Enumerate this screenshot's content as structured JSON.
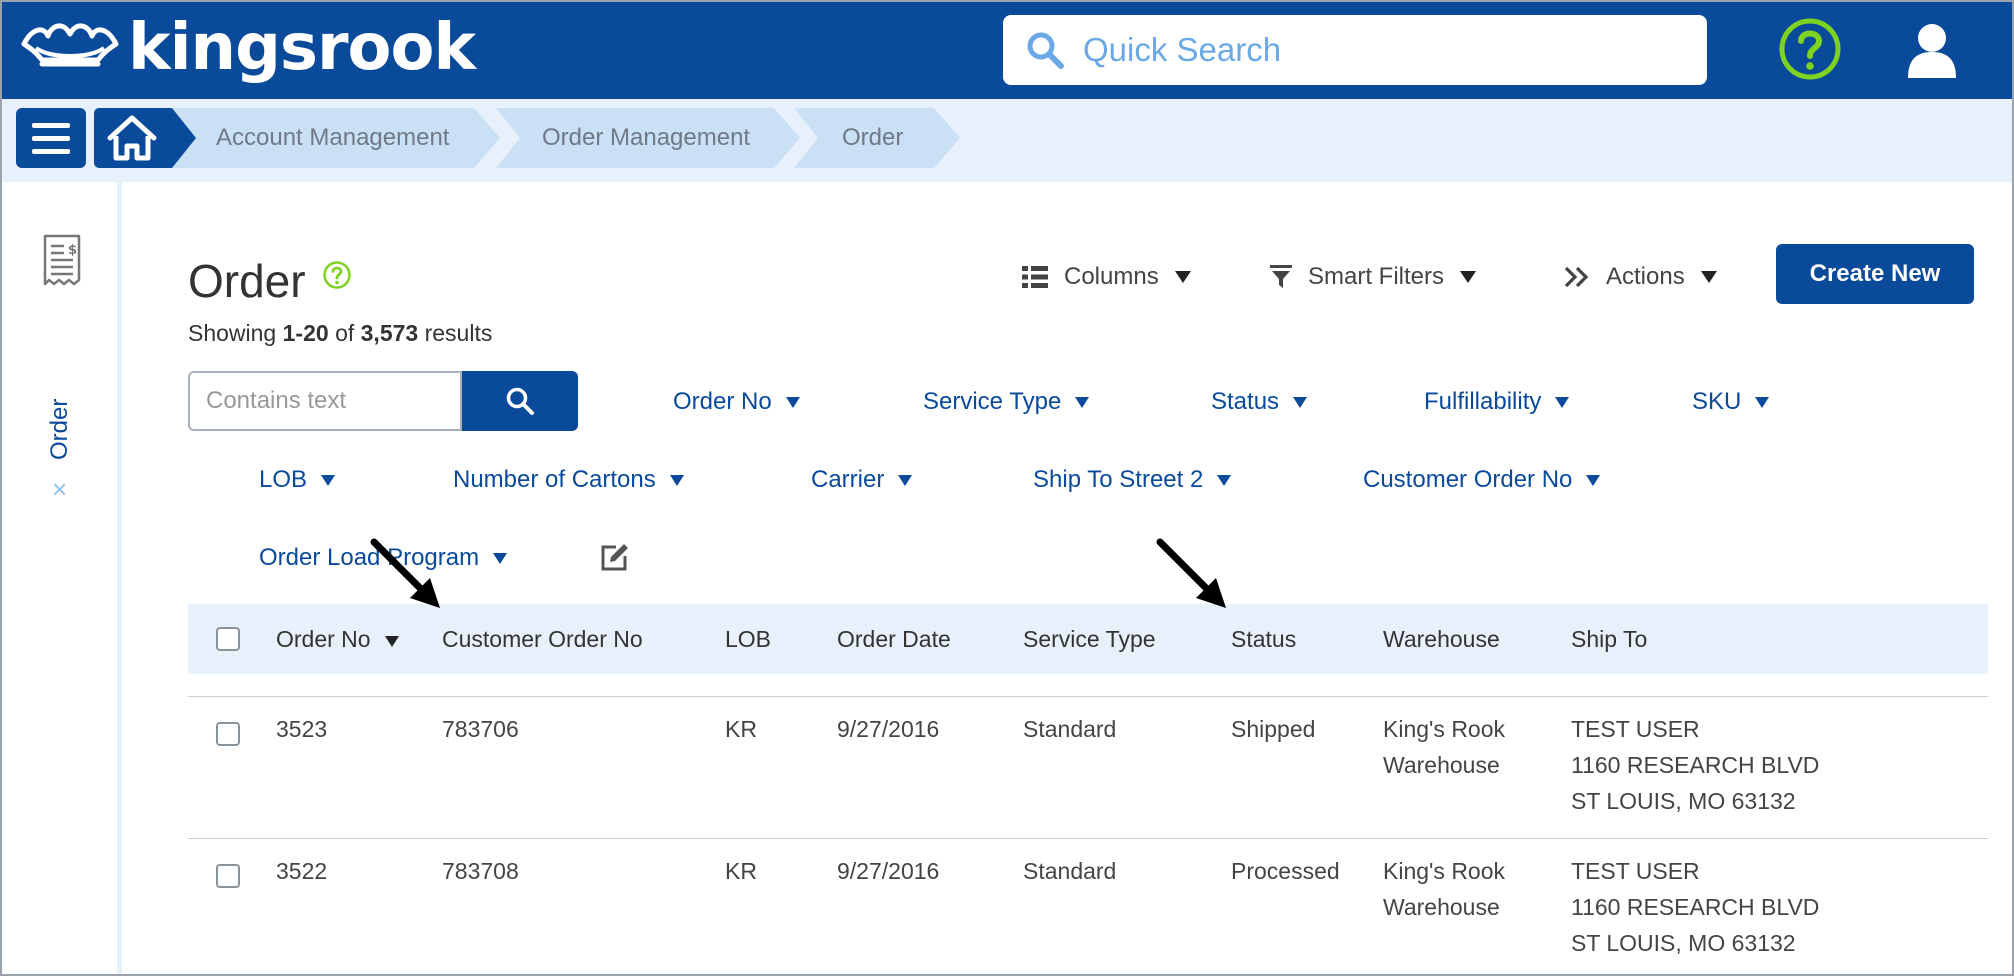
{
  "header": {
    "brand": "kingsrook",
    "search_placeholder": "Quick Search"
  },
  "breadcrumb": [
    "Account Management",
    "Order Management",
    "Order"
  ],
  "sidebar": {
    "tab_label": "Order",
    "close_glyph": "×"
  },
  "page": {
    "title": "Order",
    "showing_prefix": "Showing",
    "showing_range": "1-20",
    "showing_of": "of",
    "showing_total": "3,573",
    "showing_suffix": "results"
  },
  "toolbar": {
    "columns": "Columns",
    "smart_filters": "Smart Filters",
    "actions": "Actions",
    "create_new": "Create New"
  },
  "filters": {
    "text_placeholder": "Contains text",
    "chips": [
      "Order No",
      "Service Type",
      "Status",
      "Fulfillability",
      "SKU",
      "LOB",
      "Number of Cartons",
      "Carrier",
      "Ship To Street 2",
      "Customer Order No",
      "Order Load Program"
    ]
  },
  "table": {
    "columns": [
      "Order No",
      "Customer Order No",
      "LOB",
      "Order Date",
      "Service Type",
      "Status",
      "Warehouse",
      "Ship To"
    ],
    "rows": [
      {
        "order_no": "3523",
        "customer_order_no": "783706",
        "lob": "KR",
        "order_date": "9/27/2016",
        "service_type": "Standard",
        "status": "Shipped",
        "warehouse_1": "King's Rook",
        "warehouse_2": "Warehouse",
        "ship_to_1": "TEST USER",
        "ship_to_2": "1160 RESEARCH BLVD",
        "ship_to_3": "ST LOUIS, MO 63132"
      },
      {
        "order_no": "3522",
        "customer_order_no": "783708",
        "lob": "KR",
        "order_date": "9/27/2016",
        "service_type": "Standard",
        "status": "Processed",
        "warehouse_1": "King's Rook",
        "warehouse_2": "Warehouse",
        "ship_to_1": "TEST USER",
        "ship_to_2": "1160 RESEARCH BLVD",
        "ship_to_3": "ST LOUIS, MO 63132"
      }
    ]
  },
  "colors": {
    "brand_blue": "#0a4a9b",
    "light_blue": "#e8f1fb",
    "help_green": "#7ed321"
  }
}
